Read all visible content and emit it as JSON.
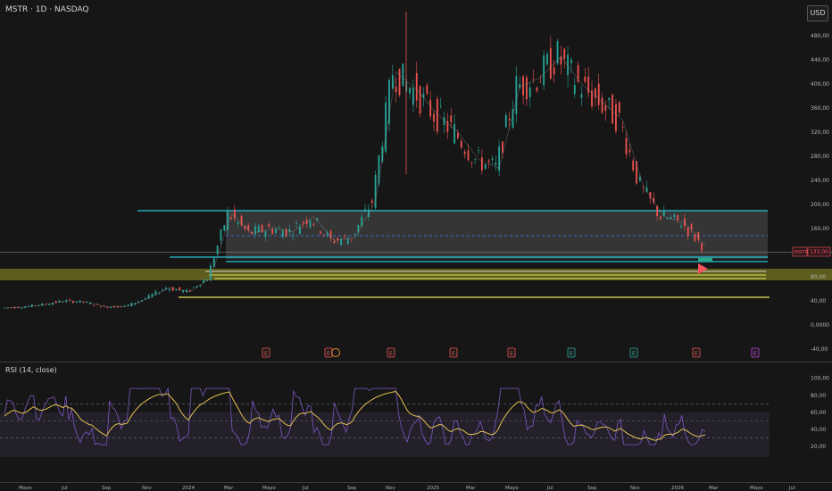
{
  "header": {
    "symbol_line": "MSTR · 1D · NASDAQ",
    "currency": "USD"
  },
  "price_panel": {
    "ticks": [
      "480,00",
      "440,00",
      "400,00",
      "360,00",
      "320,00",
      "280,00",
      "240,00",
      "200,00",
      "160,00",
      "80,00",
      "40,00",
      "0,0000",
      "-40,00"
    ],
    "tag_symbol": "MSTR",
    "tag_price": "133,00"
  },
  "rsi_panel": {
    "title": "RSI (14, close)",
    "ticks": [
      "100,00",
      "80,00",
      "60,00",
      "40,00",
      "20,00"
    ]
  },
  "time_axis": [
    "Mayo",
    "Jul",
    "Sep",
    "Nov",
    "2024",
    "Mar",
    "Mayo",
    "Jul",
    "Sep",
    "Nov",
    "2025",
    "Mar",
    "Mayo",
    "Jul",
    "Sep",
    "Nov",
    "2026",
    "Mar",
    "Mayo",
    "Jul"
  ],
  "events": [
    "E",
    "E",
    "E",
    "E",
    "E",
    "E",
    "E",
    "E",
    "E",
    "E"
  ],
  "colors": {
    "background": "#161616",
    "cyan_levels": "#26c6da",
    "yellow_levels": "#e6e65a",
    "zone_fill": "#6b6a1e",
    "up_candle": "#26a69a",
    "down_candle": "#ef5350",
    "rsi_line": "#7e57c2",
    "rsi_ma": "#e0c050",
    "price_tag": "#f7525f"
  },
  "chart_data": {
    "type": "line",
    "title": "MSTR · 1D · NASDAQ",
    "y_unit": "USD",
    "x": [
      "2023-04",
      "2023-05",
      "2023-06",
      "2023-07",
      "2023-08",
      "2023-09",
      "2023-10",
      "2023-11",
      "2023-12",
      "2024-01",
      "2024-02",
      "2024-03",
      "2024-04",
      "2024-05",
      "2024-06",
      "2024-07",
      "2024-08",
      "2024-09",
      "2024-10",
      "2024-11",
      "2024-12",
      "2025-01",
      "2025-02",
      "2025-03",
      "2025-04",
      "2025-05",
      "2025-06",
      "2025-07",
      "2025-08",
      "2025-09",
      "2025-10",
      "2025-11",
      "2025-12",
      "2026-01",
      "2026-02"
    ],
    "series": [
      {
        "values": [
          28,
          30,
          34,
          40,
          38,
          30,
          31,
          44,
          62,
          55,
          78,
          185,
          152,
          160,
          155,
          180,
          140,
          145,
          205,
          420,
          390,
          350,
          320,
          275,
          260,
          395,
          410,
          445,
          400,
          370,
          340,
          230,
          180,
          170,
          133
        ]
      }
    ],
    "ylim": [
      -40,
      500
    ],
    "rsi": {
      "ylim": [
        20,
        100
      ],
      "levels": [
        70,
        50,
        30
      ]
    }
  }
}
